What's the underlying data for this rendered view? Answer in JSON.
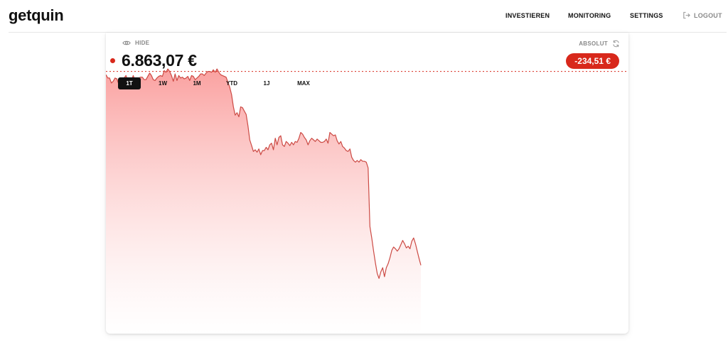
{
  "app": {
    "logo": "getquin"
  },
  "nav": {
    "items": [
      "INVESTIEREN",
      "MONITORING",
      "SETTINGS"
    ],
    "logout": "LOGOUT"
  },
  "portfolio": {
    "hide_label": "HIDE",
    "value": "6.863,07 €",
    "mode_label": "ABSOLUT",
    "change": "-234,51 €",
    "periods": [
      "1T",
      "1W",
      "1M",
      "YTD",
      "1J",
      "MAX"
    ],
    "active_period": "1T"
  },
  "colors": {
    "accent": "#d8281b",
    "line": "#cc4a44",
    "fill_top": "#fa9c9b",
    "reference_line": "#d8281b"
  },
  "chart_data": {
    "type": "area",
    "title": "",
    "xlabel": "",
    "ylabel": "",
    "values": [
      7094,
      7090,
      7090,
      7084,
      7086,
      7090,
      7089,
      7083,
      7085,
      7086,
      7090,
      7093,
      7087,
      7090,
      7087,
      7093,
      7087,
      7086,
      7090,
      7091,
      7091,
      7088,
      7088,
      7092,
      7096,
      7093,
      7088,
      7087,
      7090,
      7092,
      7093,
      7092,
      7099,
      7097,
      7101,
      7098,
      7093,
      7086,
      7095,
      7087,
      7093,
      7090,
      7091,
      7089,
      7090,
      7092,
      7087,
      7093,
      7092,
      7088,
      7090,
      7092,
      7095,
      7095,
      7093,
      7096,
      7098,
      7098,
      7097,
      7100,
      7097,
      7101,
      7097,
      7094,
      7093,
      7092,
      7091,
      7085,
      7079,
      7070,
      7055,
      7045,
      7048,
      7043,
      7055,
      7054,
      7050,
      7046,
      7032,
      7015,
      7008,
      7001,
      7003,
      7000,
      7004,
      6997,
      7002,
      7002,
      7006,
      7003,
      7009,
      7011,
      7003,
      7017,
      7009,
      7018,
      7020,
      7009,
      7007,
      7013,
      7011,
      7008,
      7012,
      7009,
      7013,
      7012,
      7017,
      7024,
      7022,
      7018,
      7015,
      7009,
      7014,
      7017,
      7015,
      7013,
      7016,
      7014,
      7012,
      7012,
      7013,
      7016,
      7011,
      7024,
      7022,
      7020,
      7021,
      7014,
      7010,
      7013,
      7007,
      7005,
      7002,
      7001,
      7004,
      6994,
      6990,
      6988,
      6990,
      6988,
      6991,
      6989,
      6989,
      6988,
      6981,
      6910,
      6896,
      6880,
      6866,
      6853,
      6847,
      6855,
      6860,
      6849,
      6860,
      6865,
      6872,
      6881,
      6885,
      6883,
      6880,
      6883,
      6888,
      6893,
      6889,
      6884,
      6886,
      6883,
      6892,
      6896,
      6889,
      6880,
      6871,
      6863
    ],
    "x_count": 288,
    "reference_value": 7098,
    "ylim": [
      6780,
      7145
    ],
    "grid": false,
    "legend": "none"
  }
}
